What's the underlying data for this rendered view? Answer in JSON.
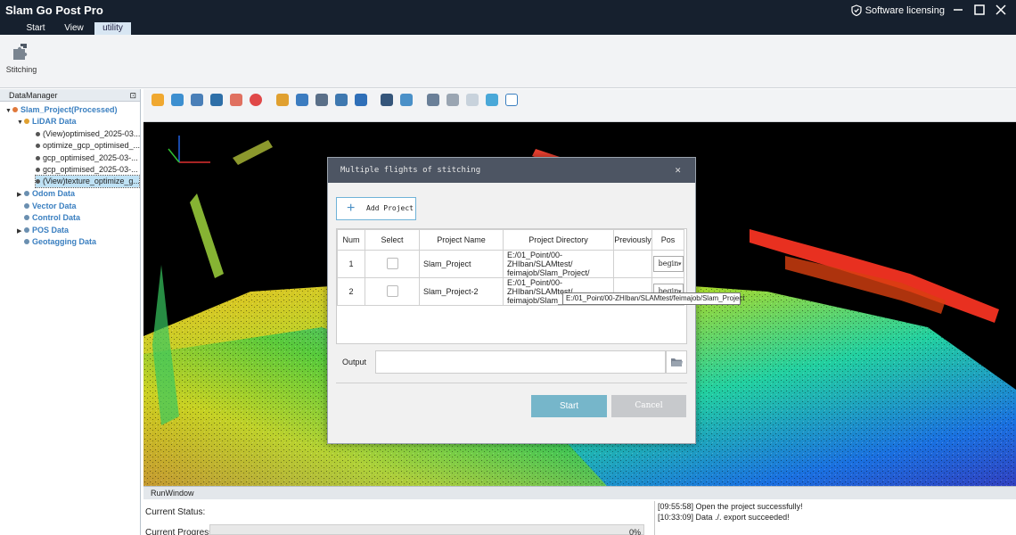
{
  "app": {
    "title": "Slam Go Post Pro",
    "licensing_label": "Software licensing",
    "icons": {
      "licensing": "shield-check-icon",
      "minimize": "minimize-icon",
      "maximize": "maximize-icon",
      "close": "close-icon"
    }
  },
  "menu": {
    "tabs": [
      {
        "label": "Start"
      },
      {
        "label": "View"
      },
      {
        "label": "utility",
        "active": true
      }
    ]
  },
  "ribbon": {
    "stitching_label": "Stitching",
    "stitching_icon": "puzzle-piece-icon"
  },
  "data_manager": {
    "title": "DataManager",
    "project": {
      "label": "Slam_Project(Processed)"
    },
    "lidar": {
      "label": "LiDAR Data"
    },
    "lidar_items": [
      {
        "label": "(View)optimised_2025-03..."
      },
      {
        "label": "optimize_gcp_optimised_..."
      },
      {
        "label": "gcp_optimised_2025-03-..."
      },
      {
        "label": "gcp_optimised_2025-03-..."
      },
      {
        "label": "(View)texture_optimize_g...",
        "selected": true
      }
    ],
    "groups": [
      {
        "label": "Odom Data",
        "expandable": true
      },
      {
        "label": "Vector Data",
        "expandable": false
      },
      {
        "label": "Control Data",
        "expandable": false
      },
      {
        "label": "POS Data",
        "expandable": true
      },
      {
        "label": "Geotagging Data",
        "expandable": false
      }
    ]
  },
  "run_window": {
    "title": "RunWindow",
    "status_label": "Current Status:",
    "progress_label": "Current Progress:",
    "progress_value": 0,
    "progress_text": "0%",
    "log": [
      "[09:55:58] Open the project successfully!",
      "[10:33:09] Data ./. export succeeded!"
    ]
  },
  "dialog": {
    "title": "Multiple flights of stitching",
    "add_project_label": "Add Project",
    "columns": {
      "num": "Num",
      "select": "Select",
      "name": "Project Name",
      "dir": "Project Directory",
      "prev": "Previously",
      "pos": "Pos"
    },
    "rows": [
      {
        "num": "1",
        "name": "Slam_Project",
        "dir_line1": "E:/01_Point/00-ZHIban/SLAMtest/",
        "dir_line2": "feimajob/Slam_Project/",
        "previously": "",
        "pos": "begin"
      },
      {
        "num": "2",
        "name": "Slam_Project-2",
        "dir_line1": "E:/01_Point/00-ZHIban/SLAMtest/",
        "dir_line2": "feimajob/Slam_Project",
        "previously": "",
        "pos": "begin"
      }
    ],
    "tooltip": "E:/01_Point/00-ZHIban/SLAMtest/feimajob/Slam_Project",
    "output_label": "Output",
    "output_value": "",
    "start_label": "Start",
    "cancel_label": "Cancel"
  },
  "colors": {
    "titlebar": "#16202e",
    "tree_folder": "#3a7fc0",
    "start_button": "#76b6ca",
    "cancel_button": "#c7c9cc",
    "dialog_title": "#4d5563"
  }
}
